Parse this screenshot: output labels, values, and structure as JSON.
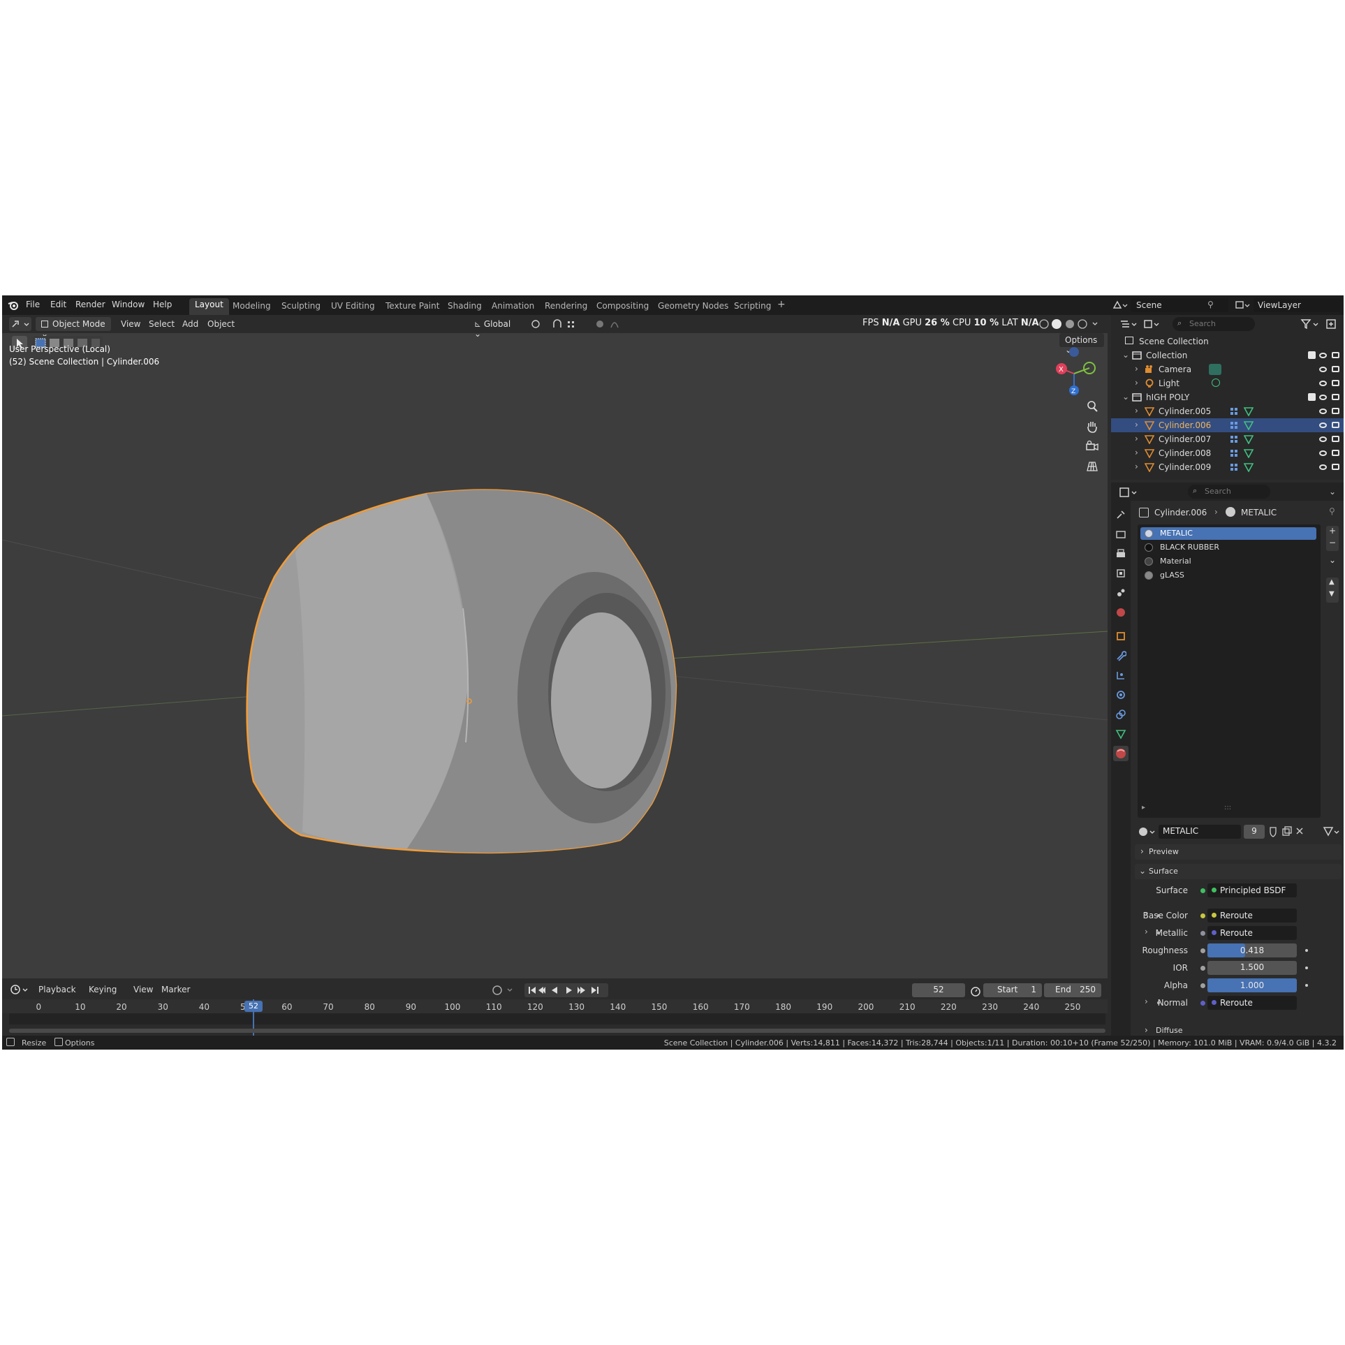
{
  "topbar": {
    "menus": [
      "File",
      "Edit",
      "Render",
      "Window",
      "Help"
    ],
    "workspaces": [
      "Layout",
      "Modeling",
      "Sculpting",
      "UV Editing",
      "Texture Paint",
      "Shading",
      "Animation",
      "Rendering",
      "Compositing",
      "Geometry Nodes",
      "Scripting"
    ],
    "active_workspace": "Layout",
    "add_tab": "+",
    "scene_name": "Scene",
    "viewlayer_name": "ViewLayer"
  },
  "viewport": {
    "mode": "Object Mode",
    "menus": [
      "View",
      "Select",
      "Add",
      "Object"
    ],
    "transform_orientation": "Global",
    "perf": {
      "fps_label": "FPS",
      "fps_value": "N/A",
      "gpu_label": "GPU",
      "gpu_value": "26 %",
      "cpu_label": "CPU",
      "cpu_value": "10 %",
      "lat_label": "LAT",
      "lat_value": "N/A"
    },
    "options_label": "Options",
    "info_line1": "User Perspective (Local)",
    "info_line2": "(52) Scene Collection | Cylinder.006",
    "gizmo": {
      "x": "X",
      "y": "Y",
      "z": "Z"
    },
    "colors": {
      "selection_outline": "#f29c38",
      "origin": "#f29c38",
      "axis_x": "#e0405a",
      "axis_y": "#80c040",
      "axis_z": "#3070d0"
    }
  },
  "timeline": {
    "menus": [
      "Playback",
      "Keying",
      "View",
      "Marker"
    ],
    "current_frame": "52",
    "start_label": "Start",
    "start_value": "1",
    "end_label": "End",
    "end_value": "250",
    "ticks": [
      "0",
      "10",
      "20",
      "30",
      "40",
      "50",
      "60",
      "70",
      "80",
      "90",
      "100",
      "110",
      "120",
      "130",
      "140",
      "150",
      "160",
      "170",
      "180",
      "190",
      "200",
      "210",
      "220",
      "230",
      "240",
      "250"
    ]
  },
  "statusbar": {
    "left_items": [
      "Resize",
      "Options"
    ],
    "stats": "Scene Collection | Cylinder.006 | Verts:14,811 | Faces:14,372 | Tris:28,744 | Objects:1/11 | Duration: 00:10+10 (Frame 52/250) | Memory: 101.0 MiB | VRAM: 0.9/4.0 GiB | 4.3.2"
  },
  "outliner": {
    "search_placeholder": "Search",
    "scene_collection": "Scene Collection",
    "rows": [
      {
        "label": "Collection",
        "indent": 1,
        "type": "collection",
        "checkbox": true
      },
      {
        "label": "Camera",
        "indent": 2,
        "type": "camera"
      },
      {
        "label": "Light",
        "indent": 2,
        "type": "light"
      },
      {
        "label": "hIGH POLY",
        "indent": 1,
        "type": "collection",
        "checkbox": true
      },
      {
        "label": "Cylinder.005",
        "indent": 2,
        "type": "mesh"
      },
      {
        "label": "Cylinder.006",
        "indent": 2,
        "type": "mesh",
        "selected": true
      },
      {
        "label": "Cylinder.007",
        "indent": 2,
        "type": "mesh"
      },
      {
        "label": "Cylinder.008",
        "indent": 2,
        "type": "mesh"
      },
      {
        "label": "Cylinder.009",
        "indent": 2,
        "type": "mesh"
      }
    ]
  },
  "properties": {
    "search_placeholder": "Search",
    "breadcrumb_object": "Cylinder.006",
    "breadcrumb_material": "METALIC",
    "material_slots": [
      "METALIC",
      "BLACK RUBBER",
      "Material",
      "gLASS"
    ],
    "active_slot": "METALIC",
    "material_name": "METALIC",
    "user_count": "9",
    "panels": {
      "preview": "Preview",
      "surface": "Surface",
      "diffuse": "Diffuse"
    },
    "surface_rows": [
      {
        "label": "Surface",
        "value": "Principled BSDF",
        "kind": "shader"
      },
      {
        "label": "Base Color",
        "value": "Reroute",
        "kind": "link",
        "expand": true
      },
      {
        "label": "Metallic",
        "value": "Reroute",
        "kind": "link",
        "expand": true
      },
      {
        "label": "Roughness",
        "value": "0.418",
        "kind": "slider",
        "fraction": 0.418
      },
      {
        "label": "IOR",
        "value": "1.500",
        "kind": "number"
      },
      {
        "label": "Alpha",
        "value": "1.000",
        "kind": "slider",
        "fraction": 1.0
      },
      {
        "label": "Normal",
        "value": "Reroute",
        "kind": "link",
        "expand": true
      }
    ]
  }
}
